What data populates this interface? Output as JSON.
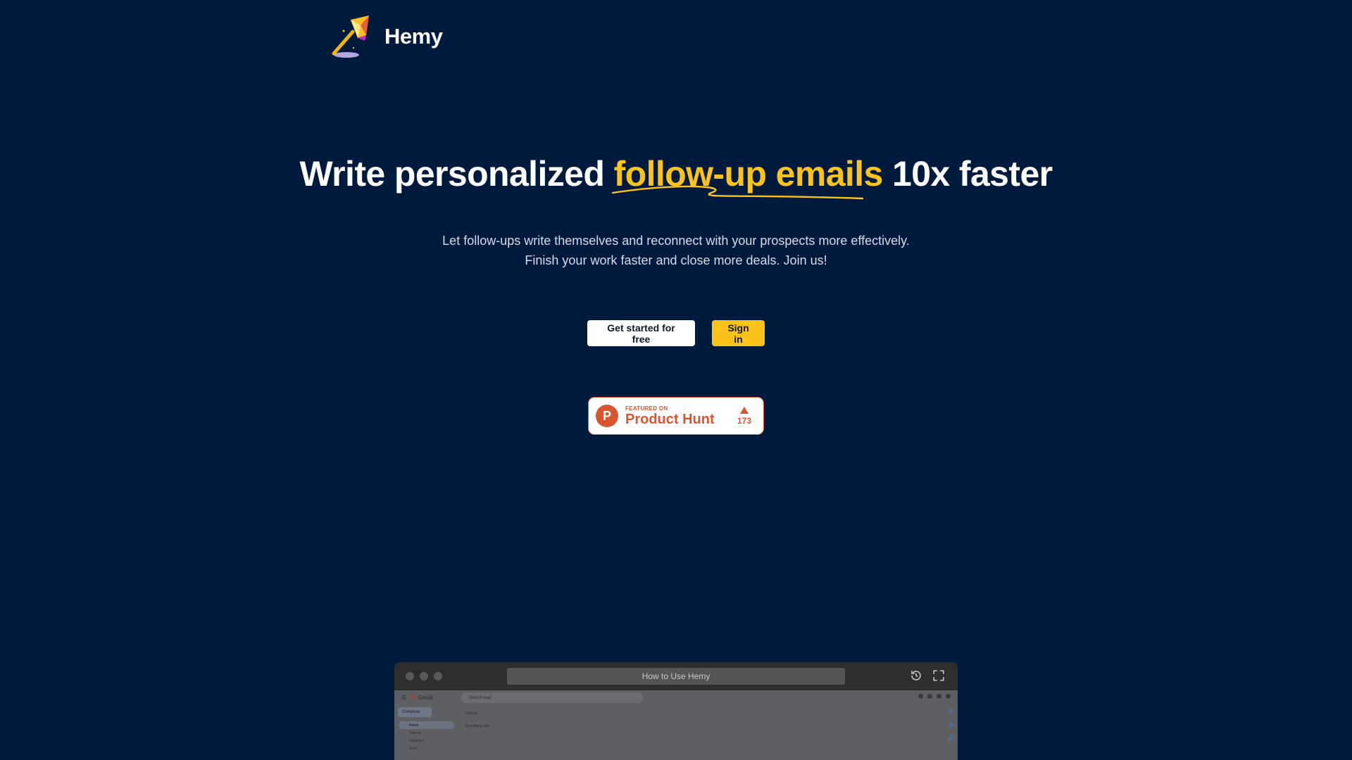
{
  "brand": {
    "name": "Hemy"
  },
  "hero": {
    "title_before": "Write personalized ",
    "title_accent": "follow-up emails",
    "title_after": " 10x faster",
    "subtitle_line1": "Let follow-ups write themselves and reconnect with your prospects more effectively.",
    "subtitle_line2": "Finish your work faster and close more deals. Join us!"
  },
  "cta": {
    "primary_label": "Get started for free",
    "signin_label": "Sign in"
  },
  "product_hunt": {
    "featured_label": "FEATURED ON",
    "name": "Product Hunt",
    "votes": "173",
    "logo_letter": "P"
  },
  "video": {
    "title": "How to Use Hemy",
    "gmail": {
      "app_name": "Gmail",
      "search_placeholder": "Search mail",
      "compose_label": "Compose",
      "nav_items": [
        "Inbox",
        "Starred",
        "Important",
        "Sent"
      ],
      "sections": [
        "Unread",
        "Everything else"
      ]
    }
  },
  "colors": {
    "background": "#001a3d",
    "accent": "#fcc419",
    "product_hunt": "#da552f"
  }
}
